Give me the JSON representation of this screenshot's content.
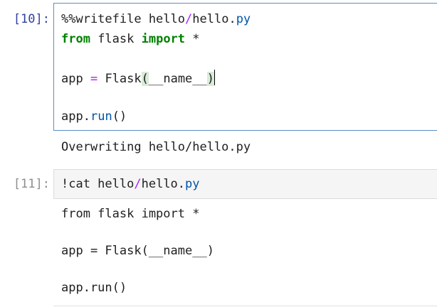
{
  "cells": [
    {
      "prompt": "[10]:",
      "magic": "%%writefile hello",
      "slash": "/",
      "file": "hello",
      "dot": ".",
      "ext": "py",
      "line2_kw1": "from",
      "line2_mod": " flask ",
      "line2_kw2": "import",
      "line2_star": " *",
      "line4_a": "app ",
      "line4_eq": "=",
      "line4_b": " Flask",
      "line4_lp": "(",
      "line4_arg": "__name__",
      "line4_rp": ")",
      "line6_a": "app",
      "line6_dot": ".",
      "line6_run": "run",
      "line6_parens": "()",
      "output": "Overwriting hello/hello.py"
    },
    {
      "prompt": "[11]:",
      "cmd": "!cat hello",
      "slash": "/",
      "file": "hello",
      "dot": ".",
      "ext": "py",
      "output": [
        "from flask import *",
        "",
        "app = Flask(__name__)",
        "",
        "app.run()"
      ]
    }
  ],
  "colors": {
    "prompt_active": "#303f9f",
    "prompt_inactive": "#8e8e8e",
    "keyword": "#008000",
    "operator": "#aa22ff",
    "attribute": "#0055aa",
    "active_border": "#5a8fc4"
  }
}
